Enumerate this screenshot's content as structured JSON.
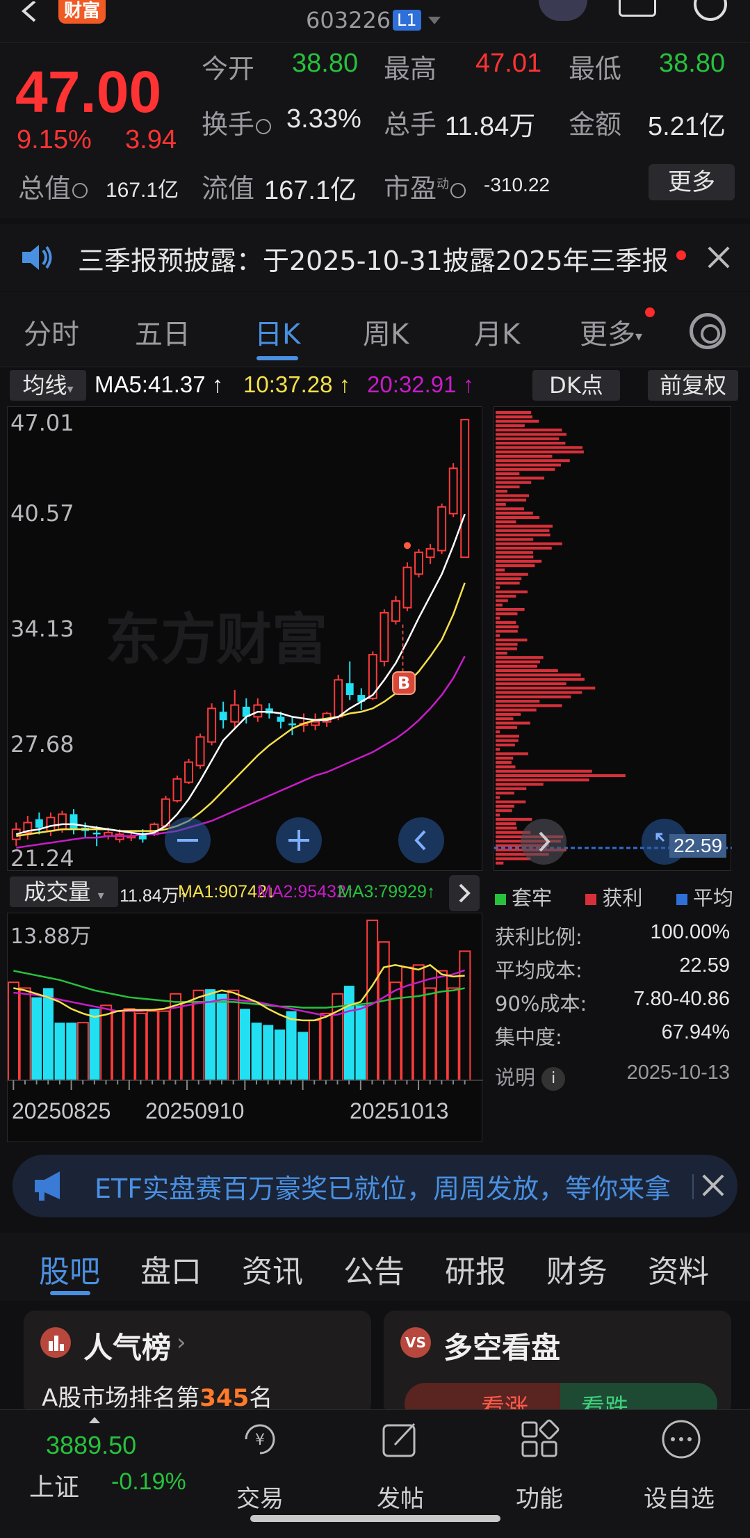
{
  "header": {
    "brand": "财富",
    "code": "603226",
    "level_badge": "L1"
  },
  "quote": {
    "price": "47.00",
    "change_pct": "9.15%",
    "change": "3.94",
    "open_label": "今开",
    "open": "38.80",
    "high_label": "最高",
    "high": "47.01",
    "low_label": "最低",
    "low": "38.80",
    "turnover_label": "换手",
    "turnover": "3.33%",
    "volume_label": "总手",
    "volume": "11.84万",
    "amount_label": "金额",
    "amount": "5.21亿",
    "mktcap_label": "总值",
    "mktcap": "167.1亿",
    "float_label": "流值",
    "float_cap": "167.1亿",
    "pe_label": "市盈",
    "pe_sup": "动",
    "pe": "-310.22",
    "more_label": "更多"
  },
  "notice": {
    "text": "三季报预披露：于2025-10-31披露2025年三季报"
  },
  "tabs": {
    "items": [
      "分时",
      "五日",
      "日K",
      "周K",
      "月K",
      "更多"
    ],
    "active": "日K"
  },
  "ma_row": {
    "selector": "均线",
    "ma5": "MA5:41.37",
    "ma10": "10:37.28",
    "ma20": "20:32.91",
    "dk_label": "DK点",
    "adjust_label": "前复权"
  },
  "kchart_axis": {
    "y_labels": [
      "47.01",
      "40.57",
      "34.13",
      "27.68",
      "21.24"
    ],
    "watermark": "东方财富",
    "signal": "B"
  },
  "chart_data": {
    "type": "candlestick",
    "ylim": [
      21.24,
      47.01
    ],
    "candles": [
      {
        "o": 22.0,
        "c": 22.6,
        "h": 23.0,
        "l": 21.6
      },
      {
        "o": 22.4,
        "c": 23.0,
        "h": 23.4,
        "l": 22.0
      },
      {
        "o": 23.2,
        "c": 22.7,
        "h": 23.6,
        "l": 22.3
      },
      {
        "o": 22.5,
        "c": 23.3,
        "h": 23.6,
        "l": 22.2
      },
      {
        "o": 22.6,
        "c": 23.5,
        "h": 23.7,
        "l": 22.4
      },
      {
        "o": 23.5,
        "c": 22.6,
        "h": 23.8,
        "l": 22.3
      },
      {
        "o": 22.7,
        "c": 22.5,
        "h": 23.0,
        "l": 22.1
      },
      {
        "o": 22.4,
        "c": 22.3,
        "h": 22.8,
        "l": 21.6
      },
      {
        "o": 22.2,
        "c": 22.4,
        "h": 22.7,
        "l": 22.0
      },
      {
        "o": 22.0,
        "c": 22.3,
        "h": 22.6,
        "l": 21.8
      },
      {
        "o": 22.1,
        "c": 22.2,
        "h": 22.5,
        "l": 21.9
      },
      {
        "o": 22.3,
        "c": 22.0,
        "h": 22.6,
        "l": 21.8
      },
      {
        "o": 22.3,
        "c": 22.9,
        "h": 23.0,
        "l": 22.2
      },
      {
        "o": 22.8,
        "c": 24.4,
        "h": 24.6,
        "l": 22.7
      },
      {
        "o": 24.3,
        "c": 25.6,
        "h": 25.8,
        "l": 24.2
      },
      {
        "o": 25.4,
        "c": 26.6,
        "h": 26.8,
        "l": 25.3
      },
      {
        "o": 26.4,
        "c": 28.1,
        "h": 28.3,
        "l": 26.2
      },
      {
        "o": 27.8,
        "c": 29.8,
        "h": 30.1,
        "l": 27.6
      },
      {
        "o": 29.6,
        "c": 29.1,
        "h": 30.2,
        "l": 28.6
      },
      {
        "o": 29.0,
        "c": 30.0,
        "h": 30.9,
        "l": 28.6
      },
      {
        "o": 29.9,
        "c": 29.3,
        "h": 30.4,
        "l": 28.9
      },
      {
        "o": 29.3,
        "c": 30.0,
        "h": 30.4,
        "l": 29.0
      },
      {
        "o": 29.8,
        "c": 29.5,
        "h": 30.1,
        "l": 29.2
      },
      {
        "o": 29.3,
        "c": 29.0,
        "h": 29.6,
        "l": 28.6
      },
      {
        "o": 28.9,
        "c": 28.8,
        "h": 29.3,
        "l": 28.2
      },
      {
        "o": 28.8,
        "c": 28.9,
        "h": 29.5,
        "l": 28.4
      },
      {
        "o": 28.8,
        "c": 29.0,
        "h": 29.5,
        "l": 28.5
      },
      {
        "o": 29.0,
        "c": 29.5,
        "h": 29.6,
        "l": 28.7
      },
      {
        "o": 29.3,
        "c": 31.5,
        "h": 31.8,
        "l": 29.1
      },
      {
        "o": 31.3,
        "c": 30.6,
        "h": 32.6,
        "l": 30.3
      },
      {
        "o": 30.6,
        "c": 30.2,
        "h": 31.0,
        "l": 29.7
      },
      {
        "o": 30.4,
        "c": 33.0,
        "h": 33.2,
        "l": 30.3
      },
      {
        "o": 32.6,
        "c": 35.5,
        "h": 35.7,
        "l": 32.3
      },
      {
        "o": 35.0,
        "c": 36.2,
        "h": 36.5,
        "l": 34.8
      },
      {
        "o": 35.8,
        "c": 38.2,
        "h": 38.5,
        "l": 35.6
      },
      {
        "o": 37.8,
        "c": 39.1,
        "h": 39.3,
        "l": 37.6
      },
      {
        "o": 38.8,
        "c": 39.3,
        "h": 39.6,
        "l": 38.4
      },
      {
        "o": 39.2,
        "c": 41.8,
        "h": 42.0,
        "l": 39.0
      },
      {
        "o": 41.4,
        "c": 44.1,
        "h": 44.4,
        "l": 41.2
      },
      {
        "o": 38.8,
        "c": 47.0,
        "h": 47.01,
        "l": 38.8
      }
    ],
    "ma5": [
      22.3,
      22.5,
      22.6,
      22.8,
      22.9,
      22.9,
      22.8,
      22.7,
      22.6,
      22.5,
      22.4,
      22.3,
      22.4,
      22.8,
      23.5,
      24.4,
      25.5,
      26.7,
      27.9,
      28.6,
      29.3,
      29.6,
      29.6,
      29.5,
      29.3,
      29.2,
      29.1,
      29.1,
      29.3,
      29.8,
      30.2,
      30.6,
      31.5,
      32.5,
      33.8,
      35.2,
      36.5,
      37.8,
      39.5,
      41.37
    ],
    "ma10": [
      22.2,
      22.3,
      22.4,
      22.5,
      22.6,
      22.6,
      22.6,
      22.6,
      22.6,
      22.5,
      22.5,
      22.5,
      22.5,
      22.6,
      22.8,
      23.1,
      23.6,
      24.2,
      24.9,
      25.6,
      26.3,
      27.0,
      27.6,
      28.1,
      28.6,
      28.9,
      29.1,
      29.2,
      29.3,
      29.5,
      29.6,
      29.8,
      30.2,
      30.7,
      31.3,
      32.0,
      32.9,
      33.9,
      35.4,
      37.28
    ],
    "ma20": [
      21.5,
      21.6,
      21.7,
      21.8,
      21.9,
      22.0,
      22.1,
      22.1,
      22.2,
      22.2,
      22.2,
      22.3,
      22.3,
      22.4,
      22.5,
      22.7,
      22.9,
      23.1,
      23.4,
      23.7,
      24.0,
      24.3,
      24.6,
      24.9,
      25.2,
      25.5,
      25.8,
      26.0,
      26.3,
      26.6,
      26.9,
      27.2,
      27.6,
      28.0,
      28.5,
      29.1,
      29.8,
      30.6,
      31.6,
      32.91
    ]
  },
  "volume": {
    "label": "成交量",
    "total": "11.84万",
    "ma1": "MA1:90742",
    "ma2": "MA2:95432",
    "ma3": "MA3:79929",
    "y_label": "13.88万",
    "dates": [
      "20250825",
      "20250910",
      "20251013"
    ],
    "ymax": 138800,
    "bars": [
      85000,
      80000,
      72000,
      80000,
      50000,
      50000,
      50000,
      62000,
      65000,
      60000,
      62000,
      58000,
      60000,
      60000,
      75000,
      68000,
      78000,
      79000,
      75000,
      78000,
      62000,
      50000,
      48000,
      44000,
      60000,
      42000,
      52000,
      58000,
      75000,
      82000,
      65000,
      138800,
      120000,
      85000,
      98000,
      100000,
      80000,
      95000,
      80000,
      112000
    ],
    "up": [
      1,
      1,
      0,
      0,
      0,
      0,
      1,
      0,
      1,
      1,
      1,
      1,
      1,
      1,
      1,
      1,
      1,
      0,
      0,
      1,
      0,
      0,
      0,
      0,
      0,
      0,
      1,
      1,
      1,
      0,
      0,
      1,
      1,
      1,
      1,
      1,
      1,
      1,
      1,
      1
    ],
    "ma5_line": [
      80000,
      78000,
      75000,
      72000,
      68000,
      62000,
      58000,
      55000,
      57000,
      60000,
      61000,
      61000,
      61000,
      62000,
      65000,
      68000,
      72000,
      75000,
      78000,
      76000,
      72000,
      68000,
      62000,
      57000,
      53000,
      52000,
      52000,
      55000,
      60000,
      65000,
      68000,
      82000,
      98000,
      100000,
      98000,
      96000,
      100000,
      92000,
      90000,
      90742
    ],
    "ma10_line": [
      76000,
      75000,
      74000,
      72000,
      70000,
      68000,
      66000,
      64000,
      62000,
      60000,
      60000,
      60000,
      61000,
      62000,
      63000,
      65000,
      67000,
      68000,
      70000,
      70000,
      69000,
      68000,
      66000,
      64000,
      62000,
      60000,
      58000,
      56000,
      57000,
      60000,
      62000,
      66000,
      72000,
      78000,
      82000,
      85000,
      88000,
      90000,
      92000,
      95432
    ],
    "ma20_line": [
      95000,
      93000,
      91000,
      89000,
      87000,
      84000,
      81000,
      78000,
      76000,
      74000,
      72000,
      71000,
      70000,
      69000,
      68000,
      68000,
      68000,
      68000,
      68000,
      68000,
      67000,
      66000,
      65000,
      64000,
      64000,
      63000,
      63000,
      63000,
      64000,
      65000,
      66000,
      67000,
      69000,
      71000,
      72000,
      73000,
      75000,
      77000,
      78000,
      79929
    ]
  },
  "profile": {
    "cost_line": "22.59",
    "legend": [
      "套牢",
      "获利",
      "平均"
    ],
    "stats": [
      {
        "label": "获利比例:",
        "value": "100.00%"
      },
      {
        "label": "平均成本:",
        "value": "22.59"
      },
      {
        "label": "90%成本:",
        "value": "7.80-40.86"
      },
      {
        "label": "集中度:",
        "value": "67.94%"
      }
    ],
    "note_label": "说明",
    "date": "2025-10-13"
  },
  "ad": {
    "text": "ETF实盘赛百万豪奖已就位，周周发放，等你来拿"
  },
  "section_tabs": [
    "股吧",
    "盘口",
    "资讯",
    "公告",
    "研报",
    "财务",
    "资料"
  ],
  "cards": {
    "popularity_title": "人气榜",
    "popularity_sub_prefix": "A股市场排名第",
    "popularity_rank": "345",
    "popularity_sub_suffix": "名",
    "bull_bear_title": "多空看盘",
    "bull_label": "看涨",
    "bear_label": "看跌"
  },
  "bottom_nav": {
    "index_value": "3889.50",
    "index_name": "上证",
    "index_change": "-0.19%",
    "items": [
      "交易",
      "发帖",
      "功能",
      "设自选"
    ]
  },
  "colors": {
    "up": "#ff3b3b",
    "down": "#22e0f2",
    "ma5": "#ffffff",
    "ma10": "#f5e14a",
    "ma20": "#c81cc8",
    "green_text": "#27c13d",
    "accent": "#4a90e2"
  }
}
